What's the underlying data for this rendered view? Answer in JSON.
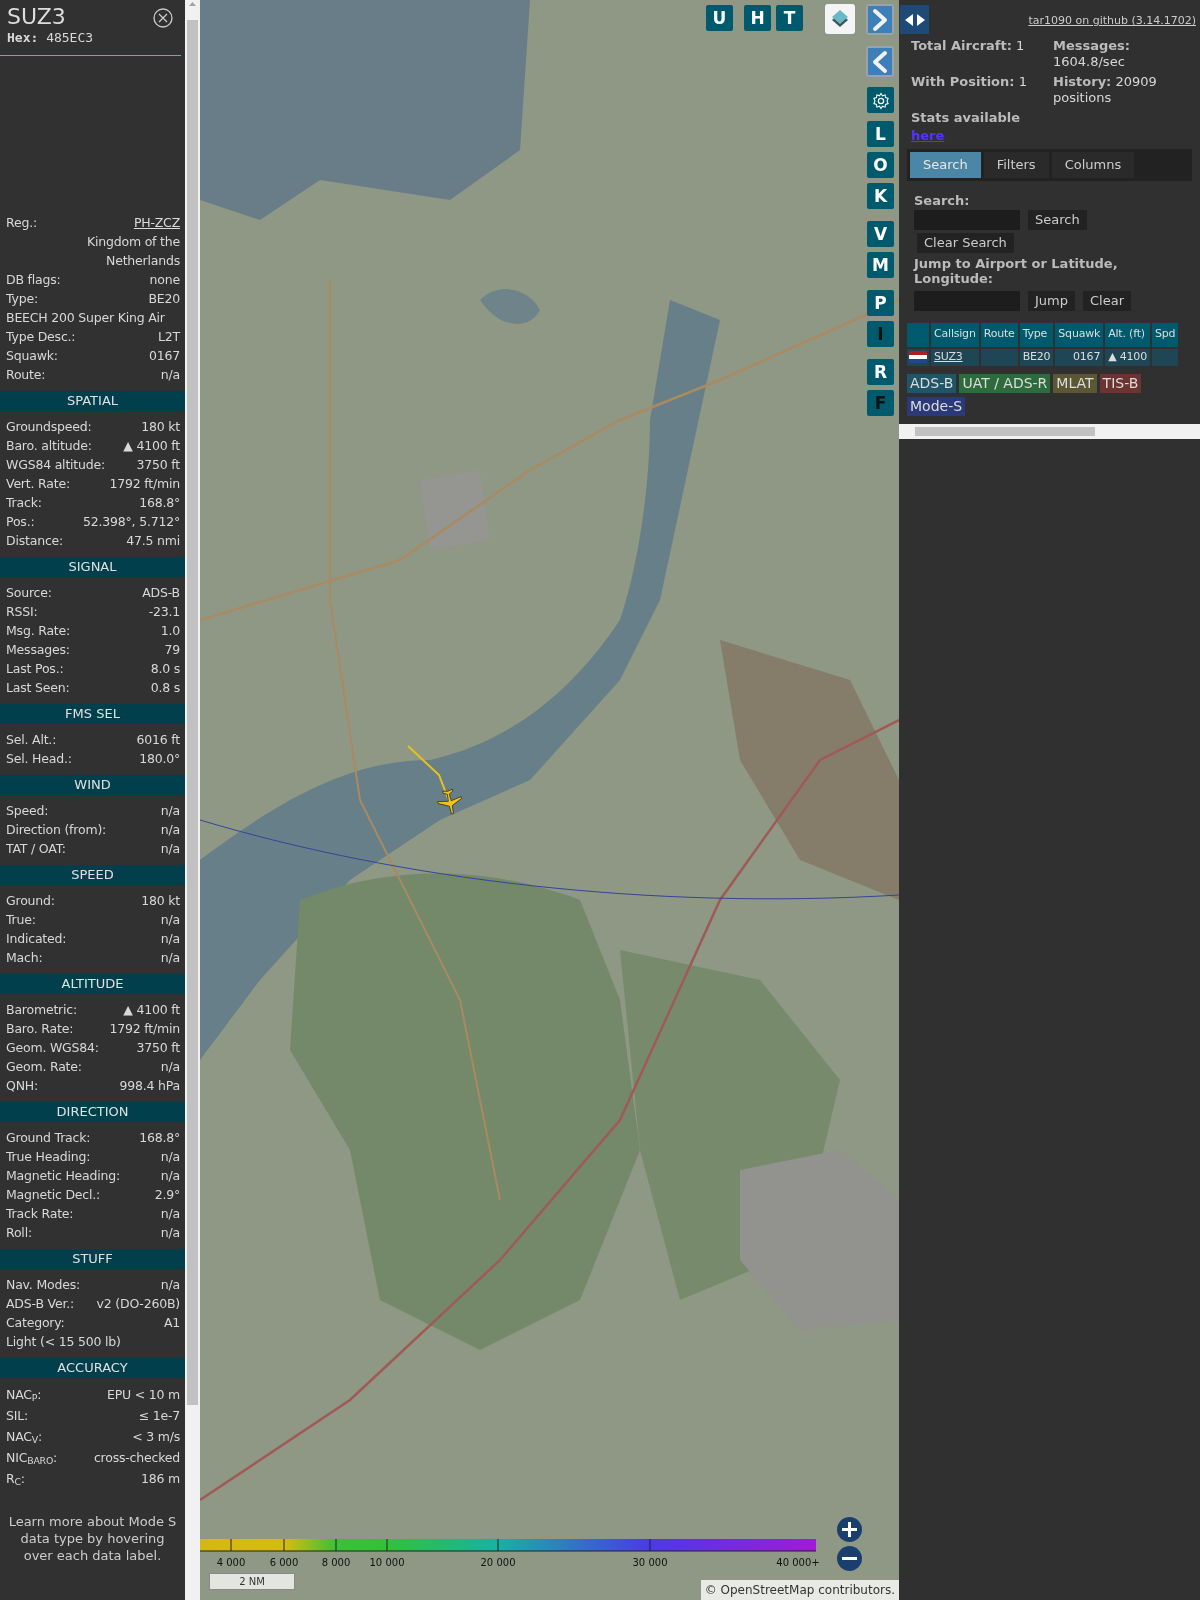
{
  "details": {
    "callsign": "SUZ3",
    "hex": "**Hex:** 485EC3",
    "info_rows": [
      {
        "kind": "link",
        "label": "Reg.:",
        "value": "PH-ZCZ"
      },
      {
        "kind": "note",
        "value": "Kingdom of the Netherlands"
      },
      {
        "kind": "pair",
        "label": "DB flags:",
        "value": "none"
      },
      {
        "kind": "pair",
        "label": "Type:",
        "value": "BE20"
      },
      {
        "kind": "full",
        "value": "BEECH 200 Super King Air"
      },
      {
        "kind": "pair",
        "label": "Type Desc.:",
        "value": "L2T"
      },
      {
        "kind": "pair",
        "label": "Squawk:",
        "value": "0167"
      },
      {
        "kind": "pair",
        "label": "Route:",
        "value": "n/a"
      }
    ],
    "sections": [
      {
        "title": "SPATIAL",
        "rows": [
          {
            "kind": "pair",
            "label": "Groundspeed:",
            "value": "180 kt"
          },
          {
            "kind": "pair",
            "label": "Baro. altitude:",
            "value": "▲ 4100 ft"
          },
          {
            "kind": "pair",
            "label": "WGS84 altitude:",
            "value": "3750 ft"
          },
          {
            "kind": "pair",
            "label": "Vert. Rate:",
            "value": "1792 ft/min"
          },
          {
            "kind": "pair",
            "label": "Track:",
            "value": "168.8°"
          },
          {
            "kind": "pair",
            "label": "Pos.:",
            "value": "52.398°, 5.712°"
          },
          {
            "kind": "pair",
            "label": "Distance:",
            "value": "47.5 nmi"
          }
        ]
      },
      {
        "title": "SIGNAL",
        "rows": [
          {
            "kind": "pair",
            "label": "Source:",
            "value": "ADS-B"
          },
          {
            "kind": "pair",
            "label": "RSSI:",
            "value": "-23.1"
          },
          {
            "kind": "pair",
            "label": "Msg. Rate:",
            "value": "1.0"
          },
          {
            "kind": "pair",
            "label": "Messages:",
            "value": "79"
          },
          {
            "kind": "pair",
            "label": "Last Pos.:",
            "value": "8.0 s"
          },
          {
            "kind": "pair",
            "label": "Last Seen:",
            "value": "0.8 s"
          }
        ]
      },
      {
        "title": "FMS SEL",
        "rows": [
          {
            "kind": "pair",
            "label": "Sel. Alt.:",
            "value": "6016 ft"
          },
          {
            "kind": "pair",
            "label": "Sel. Head.:",
            "value": "180.0°"
          }
        ]
      },
      {
        "title": "WIND",
        "rows": [
          {
            "kind": "pair",
            "label": "Speed:",
            "value": "n/a"
          },
          {
            "kind": "pair",
            "label": "Direction (from):",
            "value": "n/a"
          },
          {
            "kind": "pair",
            "label": "TAT / OAT:",
            "value": "n/a"
          }
        ]
      },
      {
        "title": "SPEED",
        "rows": [
          {
            "kind": "pair",
            "label": "Ground:",
            "value": "180 kt"
          },
          {
            "kind": "pair",
            "label": "True:",
            "value": "n/a"
          },
          {
            "kind": "pair",
            "label": "Indicated:",
            "value": "n/a"
          },
          {
            "kind": "pair",
            "label": "Mach:",
            "value": "n/a"
          }
        ]
      },
      {
        "title": "ALTITUDE",
        "rows": [
          {
            "kind": "pair",
            "label": "Barometric:",
            "value": "▲ 4100 ft"
          },
          {
            "kind": "pair",
            "label": "Baro. Rate:",
            "value": "1792 ft/min"
          },
          {
            "kind": "pair",
            "label": "Geom. WGS84:",
            "value": "3750 ft"
          },
          {
            "kind": "pair",
            "label": "Geom. Rate:",
            "value": "n/a"
          },
          {
            "kind": "pair",
            "label": "QNH:",
            "value": "998.4 hPa"
          }
        ]
      },
      {
        "title": "DIRECTION",
        "rows": [
          {
            "kind": "pair",
            "label": "Ground Track:",
            "value": "168.8°"
          },
          {
            "kind": "pair",
            "label": "True Heading:",
            "value": "n/a"
          },
          {
            "kind": "pair",
            "label": "Magnetic Heading:",
            "value": "n/a"
          },
          {
            "kind": "pair",
            "label": "Magnetic Decl.:",
            "value": "2.9°"
          },
          {
            "kind": "pair",
            "label": "Track Rate:",
            "value": "n/a"
          },
          {
            "kind": "pair",
            "label": "Roll:",
            "value": "n/a"
          }
        ]
      },
      {
        "title": "STUFF",
        "rows": [
          {
            "kind": "pair",
            "label": "Nav. Modes:",
            "value": "n/a"
          },
          {
            "kind": "pair",
            "label": "ADS-B Ver.:",
            "value": "v2 (DO-260B)"
          },
          {
            "kind": "pair",
            "label": "Category:",
            "value": "A1"
          },
          {
            "kind": "full",
            "value": "Light (< 15 500 lb)"
          }
        ]
      },
      {
        "title": "ACCURACY",
        "rows": [
          {
            "kind": "pair",
            "label": "NAC$_{P}$:",
            "value": "EPU < 10 m"
          },
          {
            "kind": "pair",
            "label": "SIL:",
            "value": "≤ 1e-7"
          },
          {
            "kind": "pair",
            "label": "NAC$_{V}$:",
            "value": "< 3 m/s"
          },
          {
            "kind": "pair",
            "label": "NIC$_{BARO}$:",
            "value": "cross-checked"
          },
          {
            "kind": "pair",
            "label": "R$_{C}$:",
            "value": "186 m"
          }
        ]
      }
    ],
    "footer": "Learn more about Mode S data type by hovering over each data label."
  },
  "map": {
    "top_buttons": [
      "U",
      "H",
      "T"
    ],
    "side_groups": [
      [
        {
          "label": "L",
          "on": true
        },
        {
          "label": "O",
          "on": true
        },
        {
          "label": "K",
          "on": true
        }
      ],
      [
        {
          "label": "V",
          "on": true
        },
        {
          "label": "M",
          "on": true
        }
      ],
      [
        {
          "label": "P",
          "on": true
        },
        {
          "label": "I",
          "on": false
        }
      ],
      [
        {
          "label": "R",
          "on": true
        },
        {
          "label": "F",
          "on": false
        }
      ]
    ],
    "altitude_legend": [
      "4 000",
      "6 000",
      "8 000",
      "10 000",
      "20 000",
      "30 000",
      "40 000+"
    ],
    "scale": "2 NM",
    "attribution": {
      "prefix": "©",
      "link": "OpenStreetMap",
      "suffix": "contributors."
    }
  },
  "panel": {
    "github_link": "tar1090 on github (3.14.1702)",
    "stats": [
      "**Total Aircraft:** 1",
      "**Messages:** 1604.8/sec",
      "**With Position:** 1",
      "**History:** 20909 positions"
    ],
    "stats_note": "Stats available",
    "stats_link": "here",
    "tabs": [
      {
        "label": "Search",
        "selected": true
      },
      {
        "label": "Filters",
        "selected": false
      },
      {
        "label": "Columns",
        "selected": false
      }
    ],
    "search_label": "Search:",
    "search_buttons": [
      "Search",
      "Clear Search"
    ],
    "jump_label": "Jump to Airport or Latitude, Longitude:",
    "jump_buttons": [
      "Jump",
      "Clear"
    ],
    "table": {
      "columns": [
        "Callsign",
        "Route",
        "Type",
        "Squawk",
        "Alt. (ft)",
        "Spd"
      ],
      "rows": [
        {
          "callsign": "SUZ3",
          "type": "BE20",
          "squawk": "0167",
          "altitude": "▲ 4100"
        }
      ]
    },
    "sources": [
      {
        "label": "ADS-B",
        "color": "#1f5566"
      },
      {
        "label": "UAT / ADS-R",
        "color": "#2d6a3c"
      },
      {
        "label": "MLAT",
        "color": "#5b5633"
      },
      {
        "label": "TIS-B",
        "color": "#6b3430"
      },
      {
        "label": "Mode-S",
        "color": "#2a3978"
      }
    ]
  }
}
